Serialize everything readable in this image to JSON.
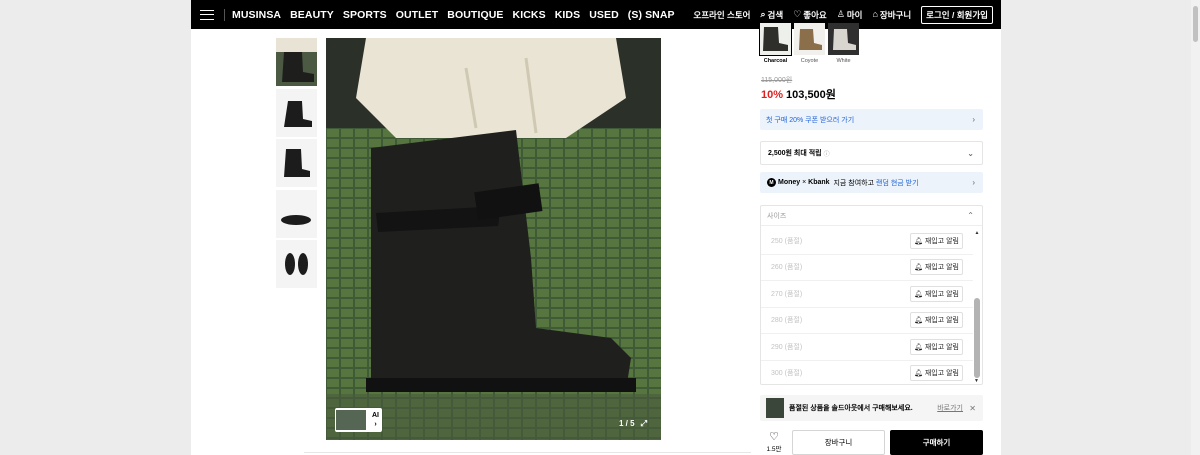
{
  "nav": {
    "links": [
      "MUSINSA",
      "BEAUTY",
      "SPORTS",
      "OUTLET",
      "BOUTIQUE",
      "KICKS",
      "KIDS",
      "USED",
      "(S) SNAP"
    ],
    "right": {
      "offline_store": "오프라인 스토어",
      "search": "검색",
      "likes": "좋아요",
      "my": "마이",
      "cart": "장바구니",
      "login": "로그인 / 회원가입"
    }
  },
  "gallery": {
    "counter": "1 / 5",
    "ai_label": "AI",
    "thumbnail_count": 5
  },
  "colors": [
    {
      "label": "Charcoal",
      "selected": true,
      "swatch": "#2e2f2b"
    },
    {
      "label": "Coyote",
      "selected": false,
      "swatch": "#8a6f4a"
    },
    {
      "label": "White",
      "selected": false,
      "swatch": "#d9d6cf"
    }
  ],
  "price": {
    "original": "115,000원",
    "discount": "10%",
    "final": "103,500원"
  },
  "coupon": {
    "text": "첫 구매 20% 쿠폰 받으러 가기"
  },
  "points": {
    "text": "2,500원 최대 적립",
    "info_icon": "ⓘ"
  },
  "money": {
    "brand1": "Money",
    "times": "×",
    "brand2": "Kbank",
    "text": "지금 참여하고",
    "link": "랜덤 현금 받기"
  },
  "size": {
    "header": "사이즈",
    "rows": [
      {
        "name": "250 (품절)",
        "action": "재입고 알림"
      },
      {
        "name": "260 (품절)",
        "action": "재입고 알림"
      },
      {
        "name": "270 (품절)",
        "action": "재입고 알림"
      },
      {
        "name": "280 (품절)",
        "action": "재입고 알림"
      },
      {
        "name": "290 (품절)",
        "action": "재입고 알림"
      },
      {
        "name": "300 (품절)",
        "action": "재입고 알림"
      }
    ]
  },
  "soldout_banner": {
    "text": "품절된 상품을 솔드아웃에서 구매해보세요.",
    "link": "바로가기"
  },
  "actions": {
    "like_count": "1.5만",
    "cart": "장바구니",
    "buy": "구매하기"
  },
  "colors_theme": {
    "accent_blue": "#1f63d6",
    "discount_red": "#e02020"
  }
}
